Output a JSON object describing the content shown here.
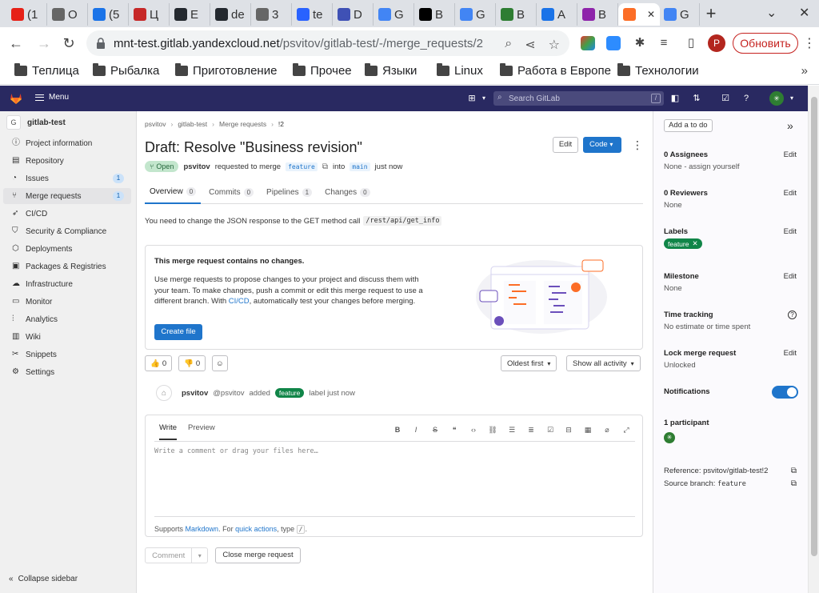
{
  "browser": {
    "tabs": [
      {
        "title": "(1",
        "color": "#e62117"
      },
      {
        "title": "O",
        "color": "#666"
      },
      {
        "title": "(5",
        "color": "#1a73e8"
      },
      {
        "title": "Ц",
        "color": "#c62828"
      },
      {
        "title": "E",
        "color": "#24292f"
      },
      {
        "title": "de",
        "color": "#24292f"
      },
      {
        "title": "3",
        "color": "#666"
      },
      {
        "title": "te",
        "color": "#2962ff"
      },
      {
        "title": "D",
        "color": "#3f51b5"
      },
      {
        "title": "G",
        "color": "#4285f4"
      },
      {
        "title": "B",
        "color": "#000"
      },
      {
        "title": "G",
        "color": "#4285f4"
      },
      {
        "title": "B",
        "color": "#2e7d32"
      },
      {
        "title": "A",
        "color": "#1a73e8"
      },
      {
        "title": "B",
        "color": "#8e24aa"
      },
      {
        "title": "",
        "color": "#fc6d26"
      },
      {
        "title": "G",
        "color": "#4285f4"
      }
    ],
    "url_host": "mnt-test.gitlab.yandexcloud.net",
    "url_path": "/psvitov/gitlab-test/-/merge_requests/2",
    "update_label": "Обновить",
    "profile_initial": "P",
    "bookmarks": [
      "Теплица",
      "Рыбалка",
      "Приготовление",
      "Прочее",
      "Языки",
      "Linux",
      "Работа в Европе",
      "Технологии"
    ]
  },
  "topbar": {
    "menu_label": "Menu",
    "search_placeholder": "Search GitLab",
    "search_shortcut": "/"
  },
  "sidebar": {
    "project_initial": "G",
    "project_name": "gitlab-test",
    "items": [
      {
        "label": "Project information",
        "icon": "info-icon"
      },
      {
        "label": "Repository",
        "icon": "doc-icon"
      },
      {
        "label": "Issues",
        "icon": "issues-icon",
        "count": "1"
      },
      {
        "label": "Merge requests",
        "icon": "merge-icon",
        "count": "1"
      },
      {
        "label": "CI/CD",
        "icon": "rocket-icon"
      },
      {
        "label": "Security & Compliance",
        "icon": "shield-icon"
      },
      {
        "label": "Deployments",
        "icon": "deploy-icon"
      },
      {
        "label": "Packages & Registries",
        "icon": "package-icon"
      },
      {
        "label": "Infrastructure",
        "icon": "cloud-icon"
      },
      {
        "label": "Monitor",
        "icon": "monitor-icon"
      },
      {
        "label": "Analytics",
        "icon": "chart-icon"
      },
      {
        "label": "Wiki",
        "icon": "book-icon"
      },
      {
        "label": "Snippets",
        "icon": "scissors-icon"
      },
      {
        "label": "Settings",
        "icon": "gear-icon"
      }
    ],
    "collapse_label": "Collapse sidebar"
  },
  "mr": {
    "breadcrumb": [
      "psvitov",
      "gitlab-test",
      "Merge requests",
      "!2"
    ],
    "title": "Draft: Resolve \"Business revision\"",
    "edit_label": "Edit",
    "code_label": "Code",
    "status": "Open",
    "author": "psvitov",
    "requested_text": "requested to merge",
    "source_branch": "feature",
    "into_text": "into",
    "target_branch": "main",
    "time_text": "just now",
    "tabs": [
      {
        "label": "Overview",
        "count": "0"
      },
      {
        "label": "Commits",
        "count": "0"
      },
      {
        "label": "Pipelines",
        "count": "1"
      },
      {
        "label": "Changes",
        "count": "0"
      }
    ],
    "description_text": "You need to change the JSON response to the GET method call",
    "description_code": "/rest/api/get_info",
    "empty_title": "This merge request contains no changes.",
    "empty_text_1": "Use merge requests to propose changes to your project and discuss them with your team. To make changes, push a commit or edit this merge request to use a different branch. With",
    "empty_link": "CI/CD",
    "empty_text_2": ", automatically test your changes before merging.",
    "create_file_label": "Create file",
    "thumbs_up": "0",
    "thumbs_down": "0",
    "sort_label": "Oldest first",
    "filter_label": "Show all activity",
    "event_author": "psvitov",
    "event_handle": "@psvitov",
    "event_action": "added",
    "event_label": "feature",
    "event_tail": "label just now",
    "write_tab": "Write",
    "preview_tab": "Preview",
    "comment_placeholder": "Write a comment or drag your files here…",
    "supports_text": "Supports",
    "markdown_link": "Markdown",
    "for_text": ". For",
    "quick_actions_link": "quick actions",
    "type_text": ", type",
    "type_kbd": "/",
    "type_tail": ".",
    "comment_label": "Comment",
    "close_label": "Close merge request"
  },
  "right": {
    "todo_label": "Add a to do",
    "assignees_h": "0 Assignees",
    "assignees_v": "None - assign yourself",
    "reviewers_h": "0 Reviewers",
    "reviewers_v": "None",
    "labels_h": "Labels",
    "label_feature": "feature",
    "milestone_h": "Milestone",
    "milestone_v": "None",
    "time_h": "Time tracking",
    "time_v": "No estimate or time spent",
    "lock_h": "Lock merge request",
    "lock_v": "Unlocked",
    "notif_h": "Notifications",
    "participants_h": "1 participant",
    "reference": "Reference: psvitov/gitlab-test!2",
    "source_label": "Source branch:",
    "source_value": "feature",
    "edit_label": "Edit"
  }
}
